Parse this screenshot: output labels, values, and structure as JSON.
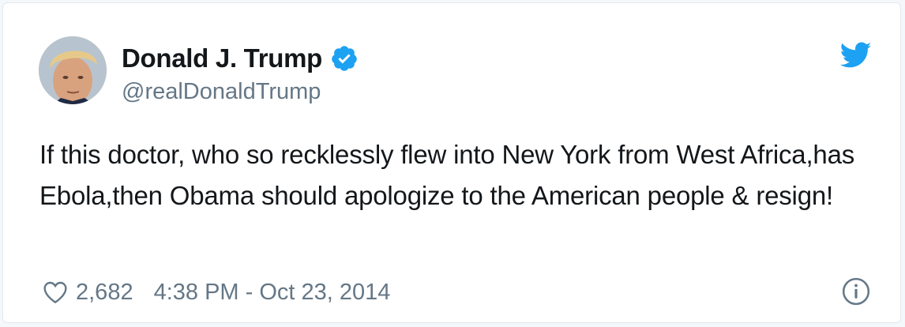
{
  "tweet": {
    "author_name": "Donald J. Trump",
    "author_handle": "@realDonaldTrump",
    "verified": true,
    "text": "If this doctor, who so recklessly flew into New York from West Africa,has Ebola,then Obama should apologize to the American people & resign!",
    "like_count": "2,682",
    "timestamp": "4:38 PM - Oct 23, 2014"
  },
  "icons": {
    "avatar": "avatar-photo",
    "verified": "verified-badge-icon",
    "brand": "twitter-bird-icon",
    "like": "heart-icon",
    "info": "info-icon"
  },
  "colors": {
    "brand": "#1da1f2",
    "text": "#14171a",
    "secondary_text": "#657786",
    "border": "#e1e8ed"
  }
}
